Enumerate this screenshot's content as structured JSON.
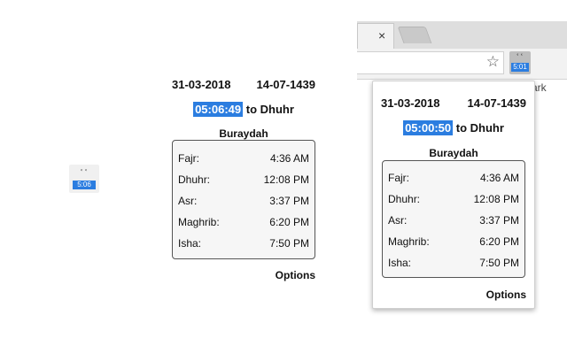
{
  "extension": {
    "icon_glyph": "ʿʿ",
    "badge_left": "5:06",
    "badge_toolbar": "5:01"
  },
  "panel_left": {
    "gregorian_date": "31-03-2018",
    "hijri_date": "14-07-1439",
    "countdown": "05:06:49",
    "next_prayer_text": "to Dhuhr",
    "city": "Buraydah",
    "times": [
      {
        "name": "Fajr:",
        "time": "4:36 AM"
      },
      {
        "name": "Dhuhr:",
        "time": "12:08 PM"
      },
      {
        "name": "Asr:",
        "time": "3:37 PM"
      },
      {
        "name": "Maghrib:",
        "time": "6:20 PM"
      },
      {
        "name": "Isha:",
        "time": "7:50 PM"
      }
    ],
    "options_label": "Options"
  },
  "browser": {
    "tab_close_glyph": "×",
    "star_glyph": "☆",
    "bookmark_peek": "ark"
  },
  "popup": {
    "gregorian_date": "31-03-2018",
    "hijri_date": "14-07-1439",
    "countdown": "05:00:50",
    "next_prayer_text": "to Dhuhr",
    "city": "Buraydah",
    "times": [
      {
        "name": "Fajr:",
        "time": "4:36 AM"
      },
      {
        "name": "Dhuhr:",
        "time": "12:08 PM"
      },
      {
        "name": "Asr:",
        "time": "3:37 PM"
      },
      {
        "name": "Maghrib:",
        "time": "6:20 PM"
      },
      {
        "name": "Isha:",
        "time": "7:50 PM"
      }
    ],
    "options_label": "Options"
  },
  "colors": {
    "accent": "#2b7de0"
  }
}
